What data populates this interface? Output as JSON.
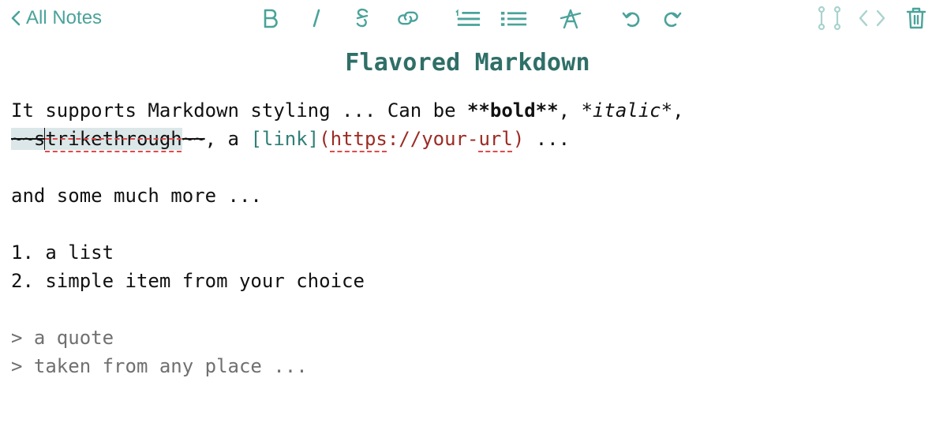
{
  "toolbar": {
    "back_label": "All Notes",
    "icons": [
      "bold-icon",
      "italic-icon",
      "strikethrough-icon",
      "link-icon",
      "ordered-list-icon",
      "unordered-list-icon",
      "clear-format-icon",
      "undo-icon",
      "redo-icon",
      "split-view-icon",
      "code-view-icon",
      "trash-icon"
    ],
    "accent": "#4aa39a"
  },
  "note": {
    "title": "Flavored Markdown",
    "line1": {
      "prefix": "It supports Markdown styling ... Can be ",
      "bold_md": "**bold**",
      "comma1": ", ",
      "italic_md": "*italic*",
      "comma2": ","
    },
    "line2": {
      "strike_open": "~~s",
      "strike_word": "trikethrough",
      "strike_close": "~~",
      "middle": ", a ",
      "link_text": "[link]",
      "url_open": "(",
      "url_https": "https",
      "url_mid": "://your-",
      "url_url": "url",
      "url_close": ")",
      "suffix": " ..."
    },
    "line3": "and some much more ...",
    "list": [
      "1. a list",
      "2. simple item from your choice"
    ],
    "quote": [
      "> a quote",
      "> taken from any place ..."
    ]
  },
  "colors": {
    "title": "#2f6f68",
    "link": "#2f7f78",
    "url": "#9c2a23",
    "quote": "#707070",
    "selection": "#dbe7e8",
    "spellcheck": "#e24a4a"
  }
}
